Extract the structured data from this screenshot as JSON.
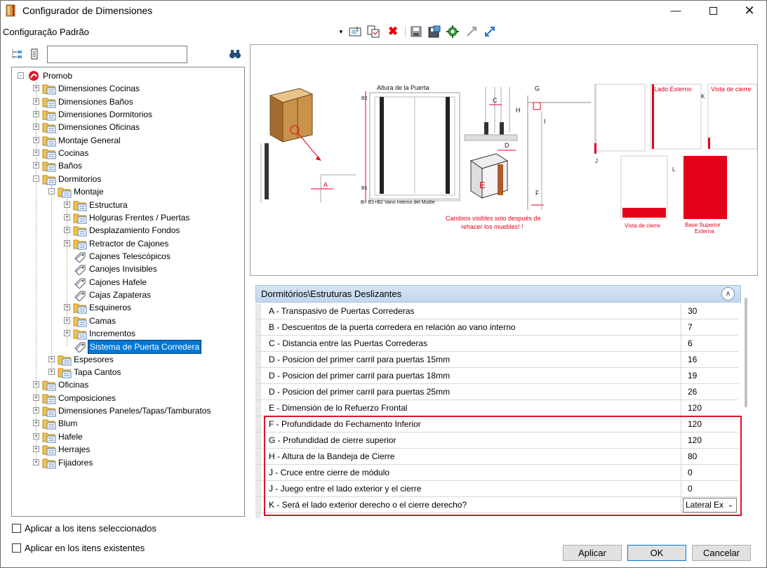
{
  "window": {
    "title": "Configurador de Dimensiones",
    "minimize_icon": "minimize-icon",
    "maximize_icon": "maximize-icon",
    "close_icon": "close-icon"
  },
  "config_bar": {
    "name": "Configuração Padrão",
    "dropdown_icon": "chevron-down-icon",
    "tools": [
      "edit-icon",
      "copy-icon",
      "delete-x-icon",
      "save-icon",
      "save-as-icon",
      "settings-gear-icon",
      "import-icon",
      "export-icon"
    ]
  },
  "tree_toolbar": {
    "expand_icon": "tree-expand-icon",
    "collapse_icon": "tree-collapse-icon",
    "search_placeholder": "",
    "search_value": "",
    "search_icon": "binoculars-icon"
  },
  "tree": {
    "root": "Promob",
    "nodes": [
      {
        "label": "Dimensiones Cocinas",
        "level": 1,
        "type": "folder",
        "expander": "+"
      },
      {
        "label": "Dimensiones Baños",
        "level": 1,
        "type": "folder",
        "expander": "+"
      },
      {
        "label": "Dimensiones Dormitorios",
        "level": 1,
        "type": "folder",
        "expander": "+"
      },
      {
        "label": "Dimensiones Oficinas",
        "level": 1,
        "type": "folder",
        "expander": "+"
      },
      {
        "label": "Montaje General",
        "level": 1,
        "type": "folder",
        "expander": "+"
      },
      {
        "label": "Cocinas",
        "level": 1,
        "type": "folder",
        "expander": "+"
      },
      {
        "label": "Baños",
        "level": 1,
        "type": "folder",
        "expander": "+"
      },
      {
        "label": "Dormitorios",
        "level": 1,
        "type": "folder",
        "expander": "-"
      },
      {
        "label": "Montaje",
        "level": 2,
        "type": "folder",
        "expander": "-"
      },
      {
        "label": "Estructura",
        "level": 3,
        "type": "folder",
        "expander": "+"
      },
      {
        "label": "Holguras Frentes / Puertas",
        "level": 3,
        "type": "folder",
        "expander": "+"
      },
      {
        "label": "Desplazamiento Fondos",
        "level": 3,
        "type": "folder",
        "expander": "+"
      },
      {
        "label": "Retractor de Cajones",
        "level": 3,
        "type": "folder",
        "expander": "+"
      },
      {
        "label": "Cajones Telescópicos",
        "level": 3,
        "type": "tag",
        "expander": ""
      },
      {
        "label": "Canojes Invisibles",
        "level": 3,
        "type": "tag",
        "expander": ""
      },
      {
        "label": "Cajones Hafele",
        "level": 3,
        "type": "tag",
        "expander": ""
      },
      {
        "label": "Cajas Zapateras",
        "level": 3,
        "type": "tag",
        "expander": ""
      },
      {
        "label": "Esquineros",
        "level": 3,
        "type": "folder",
        "expander": "+"
      },
      {
        "label": "Camas",
        "level": 3,
        "type": "folder",
        "expander": "+"
      },
      {
        "label": "Incrementos",
        "level": 3,
        "type": "folder",
        "expander": "+"
      },
      {
        "label": "Sistema de Puerta Corredera",
        "level": 3,
        "type": "tag",
        "expander": "",
        "selected": true
      },
      {
        "label": "Espesores",
        "level": 2,
        "type": "folder",
        "expander": "+"
      },
      {
        "label": "Tapa Cantos",
        "level": 2,
        "type": "folder",
        "expander": "+"
      },
      {
        "label": "Oficinas",
        "level": 1,
        "type": "folder",
        "expander": "+"
      },
      {
        "label": "Composiciones",
        "level": 1,
        "type": "folder",
        "expander": "+"
      },
      {
        "label": "Dimensiones Paneles/Tapas/Tamburatos",
        "level": 1,
        "type": "folder",
        "expander": "+"
      },
      {
        "label": "Blum",
        "level": 1,
        "type": "folder",
        "expander": "+"
      },
      {
        "label": "Hafele",
        "level": 1,
        "type": "folder",
        "expander": "+"
      },
      {
        "label": "Herrajes",
        "level": 1,
        "type": "folder",
        "expander": "+"
      },
      {
        "label": "Fijadores",
        "level": 1,
        "type": "folder",
        "expander": "+"
      }
    ]
  },
  "preview": {
    "altura_puerta": "Altura de la Puerta",
    "vano_interno": "B= B1+B2   Vano Interno del Muble",
    "b2": "B2",
    "b1": "B1",
    "a": "A",
    "c": "C",
    "d": "D",
    "e": "E",
    "f": "F",
    "g": "G",
    "h": "H",
    "i": "I",
    "j": "J",
    "k": "K",
    "l": "L",
    "cambios_1": "Cambios visibles solo después de",
    "cambios_2": "rehacer los muebles! !",
    "lado_externo": "Lado Externo",
    "vista_cierre_top": "Vista de cierre",
    "vista_cierre_bottom": "Vista de cierre",
    "base_superior_1": "Base Superior",
    "base_superior_2": "Externa",
    "accent_red": "#e3001b"
  },
  "properties": {
    "header": "Dormitórios\\Estruturas Deslizantes",
    "collapse_icon": "double-chevron-up-icon",
    "rows": [
      {
        "label": "A - Transpasivo de Puertas Correderas",
        "value": "30"
      },
      {
        "label": "B - Descuentos de la puerta corredera en relación ao vano interno",
        "value": "7"
      },
      {
        "label": "C - Distancia entre las Puertas Correderas",
        "value": "6"
      },
      {
        "label": "D - Posicion del primer carril para puertas 15mm",
        "value": "16"
      },
      {
        "label": "D - Posicion del primer carril para puertas 18mm",
        "value": "19"
      },
      {
        "label": "D - Posicion del primer carril para puertas 25mm",
        "value": "26"
      },
      {
        "label": "E - Dimensión de lo Refuerzo Frontal",
        "value": "120"
      },
      {
        "label": "F - Profundidade do Fechamento Inferior",
        "value": "120"
      },
      {
        "label": "G - Profundidad de cierre superior",
        "value": "120"
      },
      {
        "label": "H - Altura de la Bandeja de Cierre",
        "value": "80"
      },
      {
        "label": "J - Cruce entre cierre de módulo",
        "value": "0"
      },
      {
        "label": "J - Juego entre el lado exterior y el cierre",
        "value": "0"
      },
      {
        "label": "K - Será el lado exterior derecho o el cierre derecho?",
        "value": "Lateral Ex"
      }
    ],
    "highlight_color": "#d9142a"
  },
  "footer": {
    "check_selected": "Aplicar a los itens seleccionados",
    "check_existing": "Aplicar en los itens existentes",
    "apply": "Aplicar",
    "ok": "OK",
    "cancel": "Cancelar"
  }
}
